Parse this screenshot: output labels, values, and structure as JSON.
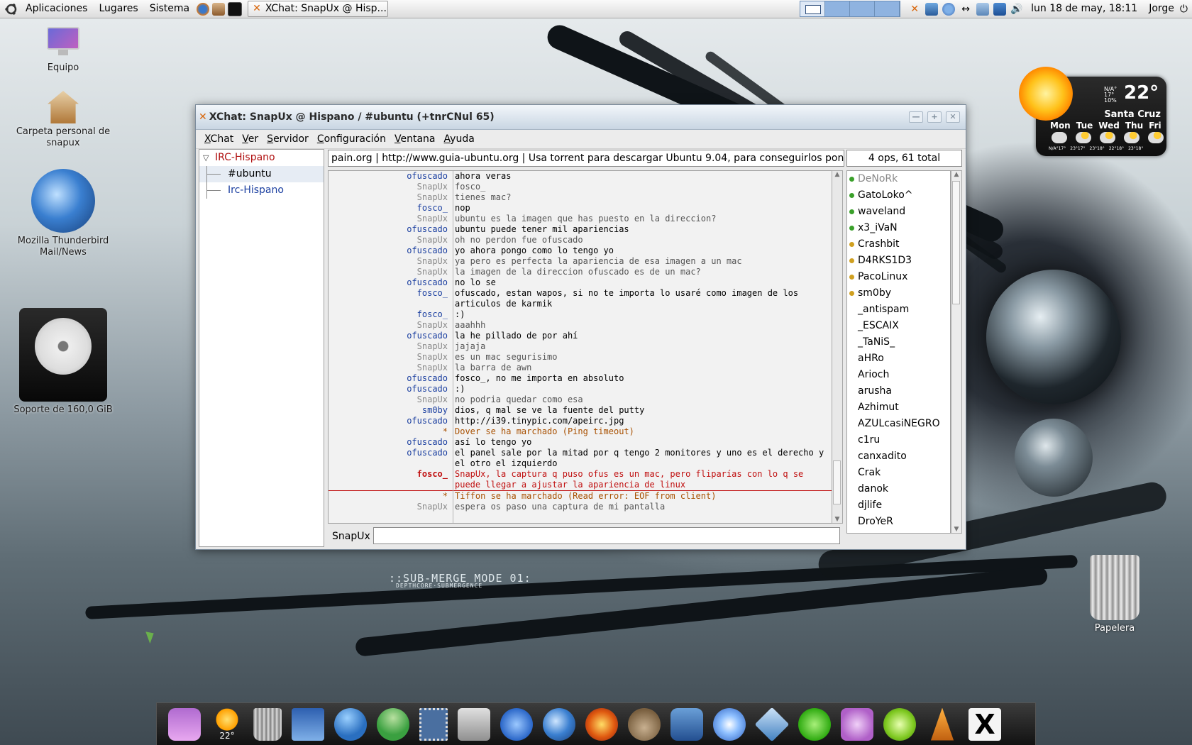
{
  "top_panel": {
    "menus": [
      "Aplicaciones",
      "Lugares",
      "Sistema"
    ],
    "task_title": "XChat: SnapUx @ Hisp...",
    "clock": "lun 18 de may, 18:11",
    "user": "Jorge"
  },
  "desktop_icons": {
    "computer": "Equipo",
    "home": "Carpeta personal de snapux",
    "thunderbird": "Mozilla Thunderbird Mail/News",
    "drive": "Soporte de 160,0 GiB",
    "trash": "Papelera"
  },
  "wallpaper_text": "::SUB-MERGE MODE 01:",
  "wallpaper_subtext": "DEPTHCORE·SUBMERGENCE",
  "weather": {
    "temp": "22°",
    "small": [
      "N/A°",
      "17°",
      "10%"
    ],
    "city": "Santa Cruz",
    "days": [
      "Mon",
      "Tue",
      "Wed",
      "Thu",
      "Fri"
    ],
    "ranges": [
      "N/A°17°",
      "23°17°",
      "23°18°",
      "22°18°",
      "23°18°"
    ]
  },
  "xchat": {
    "title": "XChat: SnapUx @ Hispano / #ubuntu (+tnrCNul 65)",
    "menu": [
      "XChat",
      "Ver",
      "Servidor",
      "Configuración",
      "Ventana",
      "Ayuda"
    ],
    "tree": {
      "server": "IRC-Hispano",
      "channel": "#ubuntu",
      "other": "Irc-Hispano"
    },
    "topic": "pain.org | http://www.guia-ubuntu.org | Usa torrent para descargar Ubuntu 9.04, para conseguirlos pon: !torrent",
    "counter": "4 ops, 61 total",
    "nick": "SnapUx",
    "colors": {
      "ofuscado": "#1b3fa0",
      "self": "#8a8a8a",
      "fosco": "#1b3fa0",
      "highlight": "#c01010",
      "event": "#a85000",
      "sm0by": "#1b3fa0"
    },
    "messages": [
      {
        "nick": "ofuscado",
        "text": "ahora veras",
        "type": "ofuscado"
      },
      {
        "nick": "SnapUx",
        "text": "fosco_",
        "type": "self"
      },
      {
        "nick": "SnapUx",
        "text": "tienes mac?",
        "type": "self"
      },
      {
        "nick": "fosco_",
        "text": "nop",
        "type": "fosco"
      },
      {
        "nick": "SnapUx",
        "text": "ubuntu es la imagen que has puesto en la direccion?",
        "type": "self"
      },
      {
        "nick": "ofuscado",
        "text": "ubuntu puede tener mil apariencias",
        "type": "ofuscado"
      },
      {
        "nick": "SnapUx",
        "text": "oh no perdon fue ofuscado",
        "type": "self"
      },
      {
        "nick": "ofuscado",
        "text": "yo ahora pongo como lo tengo yo",
        "type": "ofuscado"
      },
      {
        "nick": "SnapUx",
        "text": "ya pero es perfecta la apariencia de esa imagen a un mac",
        "type": "self"
      },
      {
        "nick": "SnapUx",
        "text": "la imagen de la direccion ofuscado es de un mac?",
        "type": "self"
      },
      {
        "nick": "ofuscado",
        "text": "no lo se",
        "type": "ofuscado"
      },
      {
        "nick": "fosco_",
        "text": "ofuscado, estan wapos, si no te importa lo usaré como imagen de los articulos de karmik",
        "type": "fosco"
      },
      {
        "nick": "fosco_",
        "text": ":)",
        "type": "fosco"
      },
      {
        "nick": "SnapUx",
        "text": "aaahhh",
        "type": "self"
      },
      {
        "nick": "ofuscado",
        "text": "la he pillado de por ahí",
        "type": "ofuscado"
      },
      {
        "nick": "SnapUx",
        "text": "jajaja",
        "type": "self"
      },
      {
        "nick": "SnapUx",
        "text": "es un mac segurisimo",
        "type": "self"
      },
      {
        "nick": "SnapUx",
        "text": "la barra de awn",
        "type": "self"
      },
      {
        "nick": "ofuscado",
        "text": "fosco_, no me importa en absoluto",
        "type": "ofuscado"
      },
      {
        "nick": "ofuscado",
        "text": ":)",
        "type": "ofuscado"
      },
      {
        "nick": "SnapUx",
        "text": "no podria quedar como esa",
        "type": "self"
      },
      {
        "nick": "sm0by",
        "text": "dios, q mal se ve la fuente del putty",
        "type": "sm0by"
      },
      {
        "nick": "ofuscado",
        "text": "http://i39.tinypic.com/apeirc.jpg",
        "type": "ofuscado"
      },
      {
        "nick": "*",
        "text": "Dover se ha marchado (Ping timeout)",
        "type": "event"
      },
      {
        "nick": "ofuscado",
        "text": "así lo tengo yo",
        "type": "ofuscado"
      },
      {
        "nick": "ofuscado",
        "text": "el panel sale por la mitad por q tengo 2 monitores y uno es el derecho y el otro el izquierdo",
        "type": "ofuscado"
      },
      {
        "nick": "fosco_",
        "text": "SnapUx, la captura q puso ofus es un mac, pero fliparías con lo q se puede llegar a ajustar la apariencia de linux",
        "type": "highlight"
      },
      {
        "nick": "*",
        "text": "Tiffon se ha marchado (Read error: EOF from client)",
        "type": "event"
      },
      {
        "nick": "SnapUx",
        "text": "espera os paso una captura de mi pantalla",
        "type": "self"
      }
    ],
    "users": [
      {
        "name": "DeNoRk",
        "status": "op",
        "away": true
      },
      {
        "name": "GatoLoko^",
        "status": "op",
        "away": false
      },
      {
        "name": "waveland",
        "status": "op",
        "away": false
      },
      {
        "name": "x3_iVaN",
        "status": "op",
        "away": false
      },
      {
        "name": "Crashbit",
        "status": "voice",
        "away": false
      },
      {
        "name": "D4RKS1D3",
        "status": "voice",
        "away": false
      },
      {
        "name": "PacoLinux",
        "status": "voice",
        "away": false
      },
      {
        "name": "sm0by",
        "status": "voice",
        "away": false
      },
      {
        "name": "_antispam",
        "status": "none",
        "away": false
      },
      {
        "name": "_ESCAIX",
        "status": "none",
        "away": false
      },
      {
        "name": "_TaNiS_",
        "status": "none",
        "away": false
      },
      {
        "name": "aHRo",
        "status": "none",
        "away": false
      },
      {
        "name": "Arioch",
        "status": "none",
        "away": false
      },
      {
        "name": "arusha",
        "status": "none",
        "away": false
      },
      {
        "name": "Azhimut",
        "status": "none",
        "away": false
      },
      {
        "name": "AZULcasiNEGRO",
        "status": "none",
        "away": false
      },
      {
        "name": "c1ru",
        "status": "none",
        "away": false
      },
      {
        "name": "canxadito",
        "status": "none",
        "away": false
      },
      {
        "name": "Crak",
        "status": "none",
        "away": false
      },
      {
        "name": "danok",
        "status": "none",
        "away": false
      },
      {
        "name": "djlife",
        "status": "none",
        "away": false
      },
      {
        "name": "DroYeR",
        "status": "none",
        "away": false
      }
    ]
  },
  "dock": {
    "weather_temp": "22°",
    "apps": [
      "display-settings",
      "weather",
      "trash",
      "desktop",
      "messenger",
      "contacts",
      "stamp",
      "install",
      "ichat",
      "thunderbird",
      "firefox",
      "gimp",
      "mail",
      "itunes",
      "virtualbox",
      "skype",
      "settings",
      "limewire",
      "vlc",
      "x11"
    ]
  }
}
